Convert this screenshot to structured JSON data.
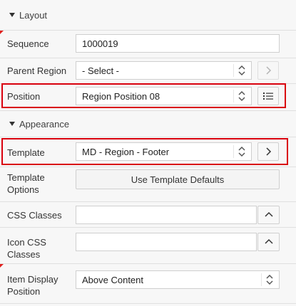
{
  "sections": {
    "layout": "Layout",
    "appearance": "Appearance"
  },
  "fields": {
    "sequence": {
      "label": "Sequence",
      "value": "1000019"
    },
    "parent_region": {
      "label": "Parent Region",
      "value": "- Select -"
    },
    "position": {
      "label": "Position",
      "value": "Region Position 08"
    },
    "template": {
      "label": "Template",
      "value": "MD - Region - Footer"
    },
    "template_options": {
      "label_line1": "Template",
      "label_line2": "Options",
      "button": "Use Template Defaults"
    },
    "css_classes": {
      "label": "CSS Classes",
      "value": ""
    },
    "icon_css_classes": {
      "label_line1": "Icon CSS",
      "label_line2": "Classes",
      "value": ""
    },
    "item_display_position": {
      "label_line1": "Item Display",
      "label_line2": "Position",
      "value": "Above Content"
    }
  },
  "icons": {
    "select_arrows": "up-down-chevrons-icon",
    "go_to": "chevron-right-icon",
    "list": "list-icon",
    "expand": "chevron-up-icon"
  },
  "colors": {
    "highlight": "#d9000d",
    "required_marker": "#e0201e"
  }
}
